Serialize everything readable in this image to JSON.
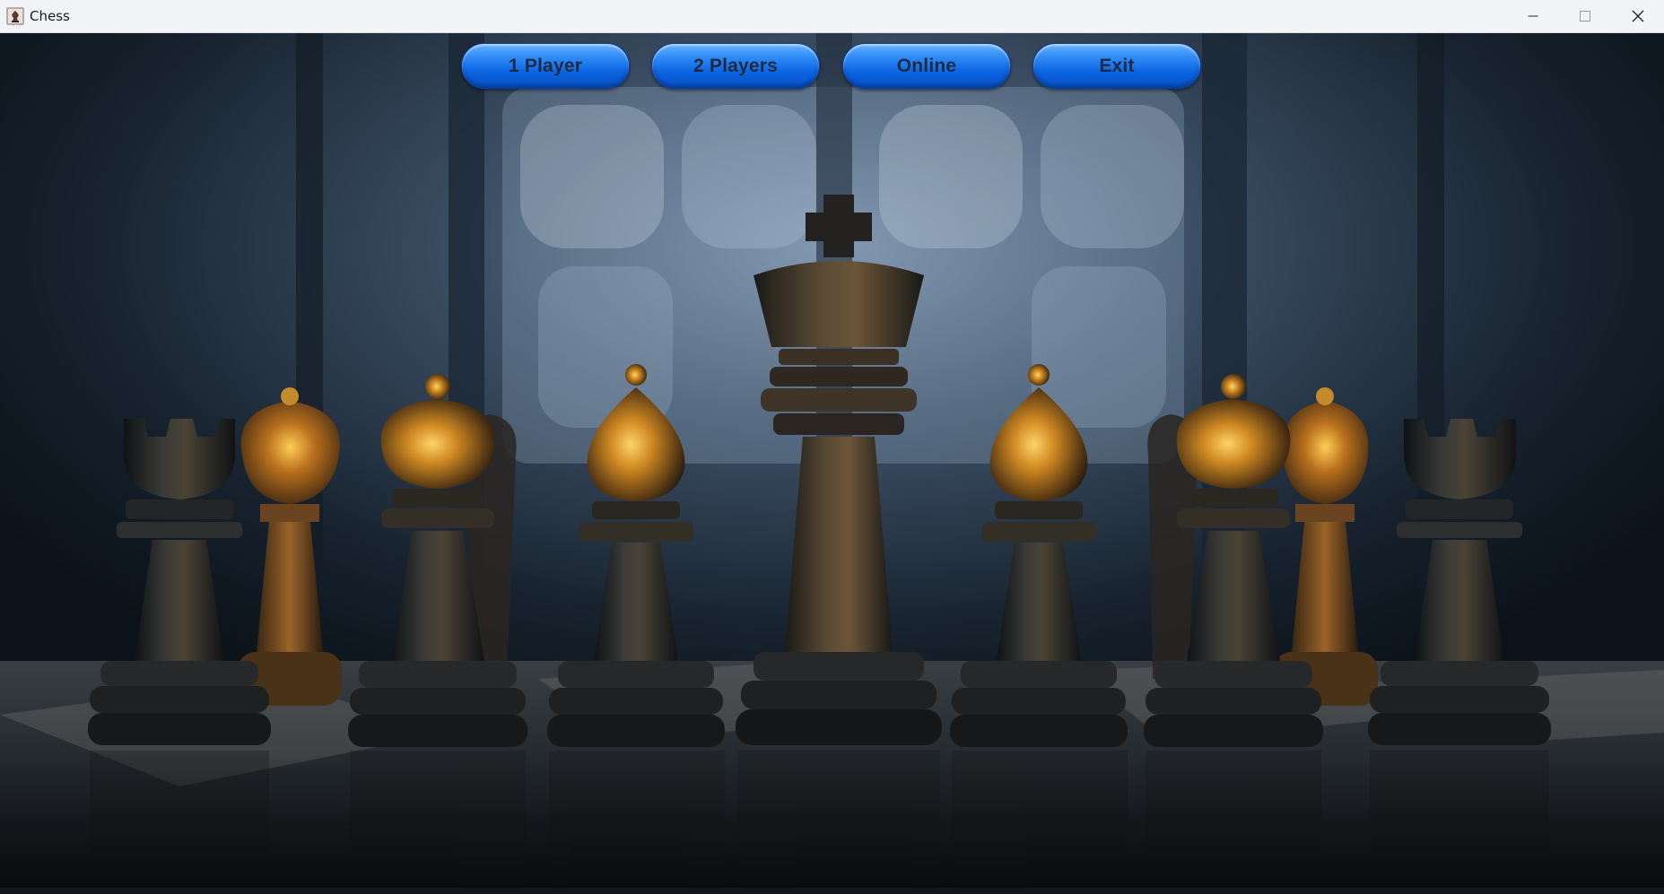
{
  "window": {
    "title": "Chess",
    "app_icon": "chess-piece-icon",
    "controls": {
      "minimize_icon": "minimize-icon",
      "maximize_icon": "maximize-icon",
      "close_icon": "close-icon"
    }
  },
  "menu": {
    "one_player_label": "1 Player",
    "two_players_label": "2 Players",
    "online_label": "Online",
    "exit_label": "Exit"
  },
  "colors": {
    "button_blue": "#0d66e2",
    "button_text": "#1d2a44",
    "titlebar_bg": "#f3f4f8"
  }
}
